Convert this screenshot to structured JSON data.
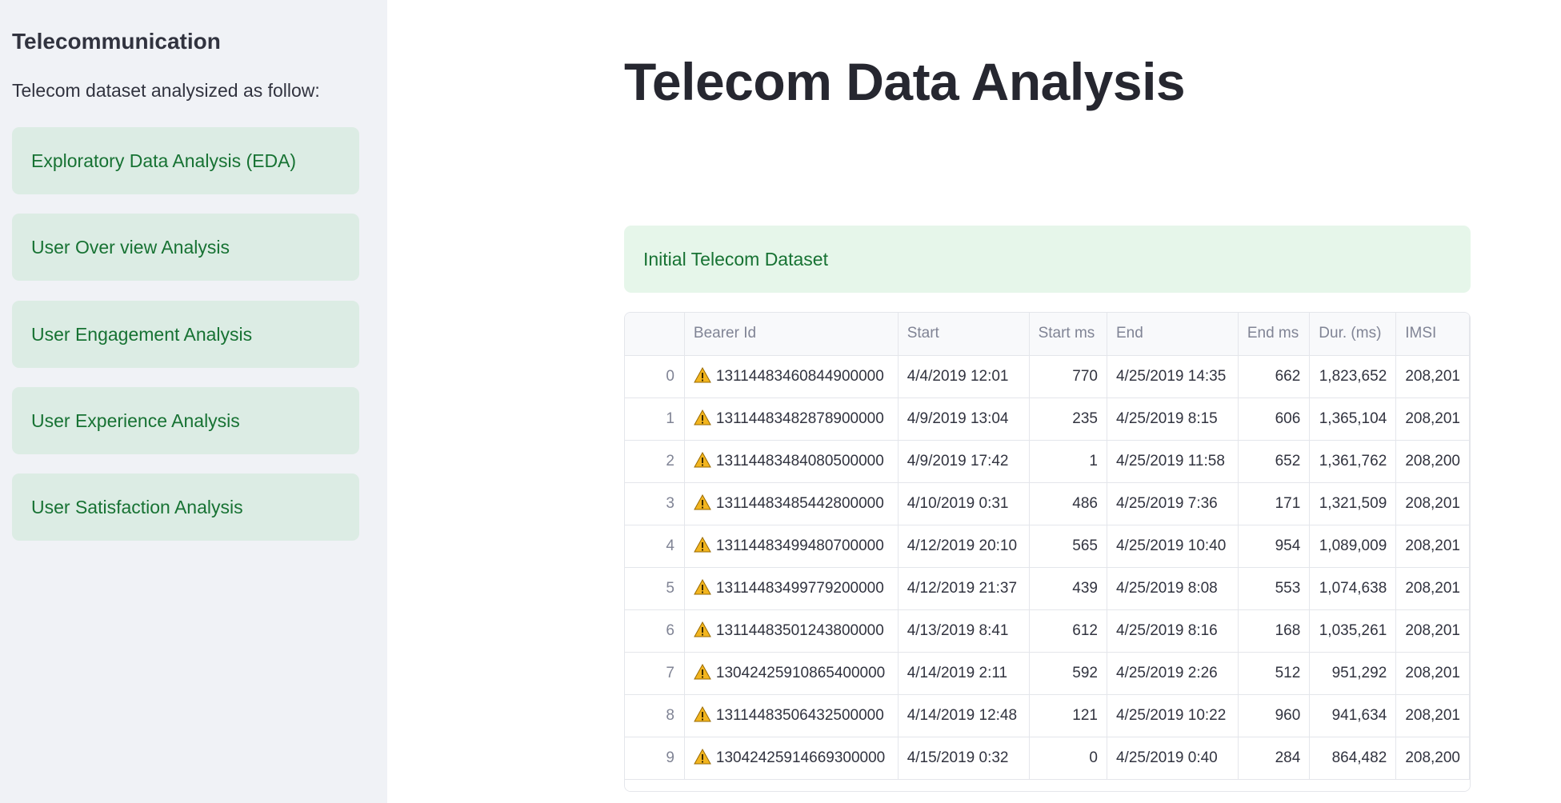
{
  "sidebar": {
    "heading": "Telecommunication",
    "description": "Telecom dataset analysized as follow:",
    "items": [
      {
        "label": "Exploratory Data Analysis (EDA)"
      },
      {
        "label": "User Over view Analysis"
      },
      {
        "label": "User Engagement Analysis"
      },
      {
        "label": "User Experience Analysis"
      },
      {
        "label": "User Satisfaction Analysis"
      }
    ]
  },
  "main": {
    "title": "Telecom Data Analysis",
    "info_box": "Initial Telecom Dataset"
  },
  "table": {
    "columns": [
      "",
      "Bearer Id",
      "Start",
      "Start ms",
      "End",
      "End ms",
      "Dur. (ms)",
      "IMSI"
    ],
    "warning_icon": "warning-icon",
    "rows": [
      {
        "index": "0",
        "bearer_id": "13114483460844900000",
        "start": "4/4/2019 12:01",
        "start_ms": "770",
        "end": "4/25/2019 14:35",
        "end_ms": "662",
        "dur": "1,823,652",
        "imsi": "208,201"
      },
      {
        "index": "1",
        "bearer_id": "13114483482878900000",
        "start": "4/9/2019 13:04",
        "start_ms": "235",
        "end": "4/25/2019 8:15",
        "end_ms": "606",
        "dur": "1,365,104",
        "imsi": "208,201"
      },
      {
        "index": "2",
        "bearer_id": "13114483484080500000",
        "start": "4/9/2019 17:42",
        "start_ms": "1",
        "end": "4/25/2019 11:58",
        "end_ms": "652",
        "dur": "1,361,762",
        "imsi": "208,200"
      },
      {
        "index": "3",
        "bearer_id": "13114483485442800000",
        "start": "4/10/2019 0:31",
        "start_ms": "486",
        "end": "4/25/2019 7:36",
        "end_ms": "171",
        "dur": "1,321,509",
        "imsi": "208,201"
      },
      {
        "index": "4",
        "bearer_id": "13114483499480700000",
        "start": "4/12/2019 20:10",
        "start_ms": "565",
        "end": "4/25/2019 10:40",
        "end_ms": "954",
        "dur": "1,089,009",
        "imsi": "208,201"
      },
      {
        "index": "5",
        "bearer_id": "13114483499779200000",
        "start": "4/12/2019 21:37",
        "start_ms": "439",
        "end": "4/25/2019 8:08",
        "end_ms": "553",
        "dur": "1,074,638",
        "imsi": "208,201"
      },
      {
        "index": "6",
        "bearer_id": "13114483501243800000",
        "start": "4/13/2019 8:41",
        "start_ms": "612",
        "end": "4/25/2019 8:16",
        "end_ms": "168",
        "dur": "1,035,261",
        "imsi": "208,201"
      },
      {
        "index": "7",
        "bearer_id": "13042425910865400000",
        "start": "4/14/2019 2:11",
        "start_ms": "592",
        "end": "4/25/2019 2:26",
        "end_ms": "512",
        "dur": "951,292",
        "imsi": "208,201"
      },
      {
        "index": "8",
        "bearer_id": "13114483506432500000",
        "start": "4/14/2019 12:48",
        "start_ms": "121",
        "end": "4/25/2019 10:22",
        "end_ms": "960",
        "dur": "941,634",
        "imsi": "208,201"
      },
      {
        "index": "9",
        "bearer_id": "13042425914669300000",
        "start": "4/15/2019 0:32",
        "start_ms": "0",
        "end": "4/25/2019 0:40",
        "end_ms": "284",
        "dur": "864,482",
        "imsi": "208,200"
      }
    ]
  }
}
